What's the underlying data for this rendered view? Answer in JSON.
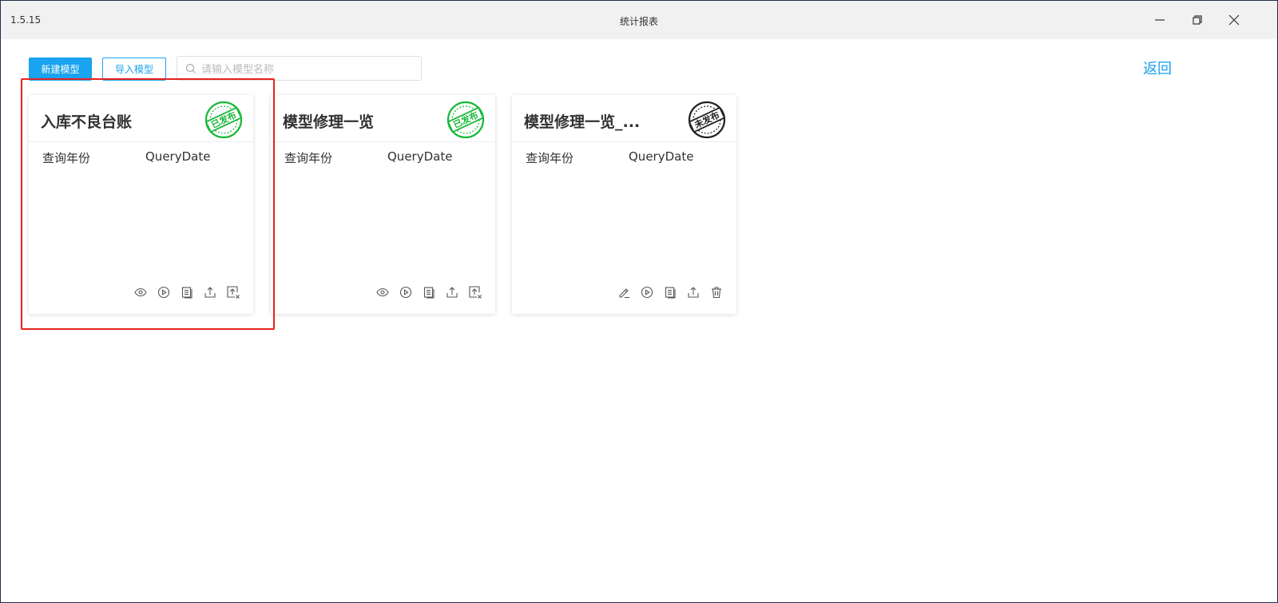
{
  "window": {
    "version": "1.5.15",
    "title": "统计报表"
  },
  "toolbar": {
    "new_model_label": "新建模型",
    "import_model_label": "导入模型",
    "search_placeholder": "请输入模型名称",
    "search_value": "",
    "back_label": "返回"
  },
  "colors": {
    "accent": "#1aa3ee",
    "published_stamp": "#19b83a",
    "unpublished_stamp": "#222222",
    "highlight_border": "#e8231f"
  },
  "cards": [
    {
      "title": "入库不良台账",
      "status": "已发布",
      "param_label": "查询年份",
      "param_value": "QueryDate",
      "actions": [
        "eye-icon",
        "play-icon",
        "copy-icon",
        "export-icon",
        "unpublish-icon"
      ]
    },
    {
      "title": "模型修理一览",
      "status": "已发布",
      "param_label": "查询年份",
      "param_value": "QueryDate",
      "actions": [
        "eye-icon",
        "play-icon",
        "copy-icon",
        "export-icon",
        "unpublish-icon"
      ]
    },
    {
      "title": "模型修理一览_...",
      "status": "未发布",
      "param_label": "查询年份",
      "param_value": "QueryDate",
      "actions": [
        "edit-icon",
        "play-icon",
        "copy-icon",
        "export-icon",
        "delete-icon"
      ]
    }
  ]
}
